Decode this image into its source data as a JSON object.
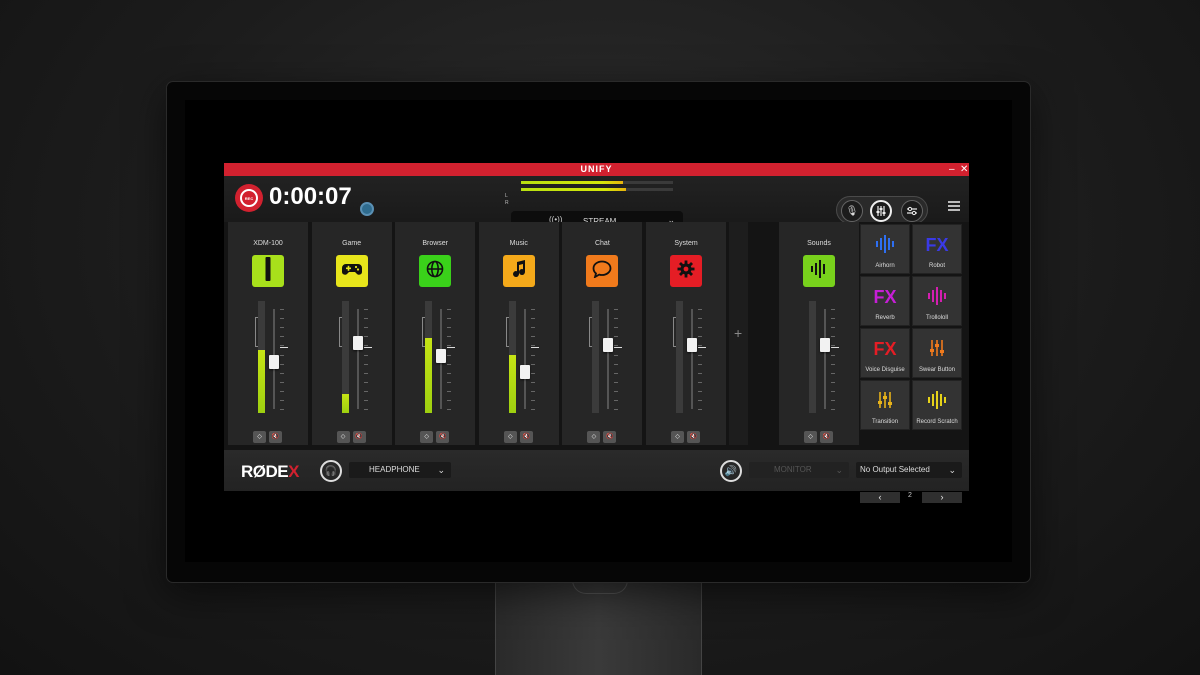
{
  "app": {
    "title": "UNIFY",
    "minimize": "–",
    "close": "✕"
  },
  "header": {
    "rec_label": "REC",
    "timer": "0:00:07",
    "meter_labels": {
      "left": "L",
      "right": "R"
    },
    "meters": [
      {
        "level": 0.67
      },
      {
        "level": 0.69
      }
    ],
    "output_select": {
      "label": "STREAM",
      "icon": "broadcast-icon"
    },
    "view_buttons": [
      {
        "icon": "mic-view-icon",
        "active": false
      },
      {
        "icon": "mixer-view-icon",
        "active": true
      },
      {
        "icon": "settings-sliders-icon",
        "active": false
      }
    ],
    "menu_icon": "hamburger-icon"
  },
  "mixer": {
    "monitor_indicator_icon": "headphone-icon",
    "channels": [
      {
        "name": "XDM-100",
        "icon": "microphone-icon",
        "color": "#a8e01b",
        "vu": 0.56,
        "fader": 0.47,
        "bracket": true
      },
      {
        "name": "Game",
        "icon": "gamepad-icon",
        "color": "#e7e51b",
        "vu": 0.17,
        "fader": 0.66,
        "bracket": true
      },
      {
        "name": "Browser",
        "icon": "globe-icon",
        "color": "#3ad11a",
        "vu": 0.67,
        "fader": 0.53,
        "bracket": true
      },
      {
        "name": "Music",
        "icon": "music-note-icon",
        "color": "#f4a91a",
        "vu": 0.52,
        "fader": 0.37,
        "bracket": true
      },
      {
        "name": "Chat",
        "icon": "chat-bubble-icon",
        "color": "#f07a1c",
        "vu": 0.0,
        "fader": 0.64,
        "bracket": true
      },
      {
        "name": "System",
        "icon": "gear-icon",
        "color": "#e51d25",
        "vu": 0.0,
        "fader": 0.64,
        "bracket": true
      }
    ],
    "add_channel_label": "+",
    "sounds": {
      "name": "Sounds",
      "icon": "waveform-icon",
      "color": "#78d11c",
      "vu": 0.0,
      "fader": 0.64
    },
    "pads": [
      {
        "label": "Airhorn",
        "glyph": "waveform",
        "color": "#2e6ff2"
      },
      {
        "label": "Robot",
        "glyph": "FX",
        "color": "#3a3ae6"
      },
      {
        "label": "Reverb",
        "glyph": "FX",
        "color": "#c61fd6"
      },
      {
        "label": "Trollololl",
        "glyph": "waveform",
        "color": "#d41fb0"
      },
      {
        "label": "Voice Disguise",
        "glyph": "FX",
        "color": "#e51d25"
      },
      {
        "label": "Swear Button",
        "glyph": "sliders",
        "color": "#f07a1c"
      },
      {
        "label": "Transition",
        "glyph": "sliders",
        "color": "#e6b21a"
      },
      {
        "label": "Record Scratch",
        "glyph": "waveform",
        "color": "#e6d21a"
      }
    ],
    "pad_prev": "‹",
    "pad_next": "›",
    "pad_page": "2"
  },
  "footer": {
    "logo_text": "RØDE",
    "logo_x": "X",
    "headphone": {
      "icon": "headphone-icon",
      "label": "HEADPHONE"
    },
    "speaker": {
      "icon": "speaker-icon",
      "label": "MONITOR"
    },
    "output": {
      "label": "No Output Selected"
    }
  }
}
